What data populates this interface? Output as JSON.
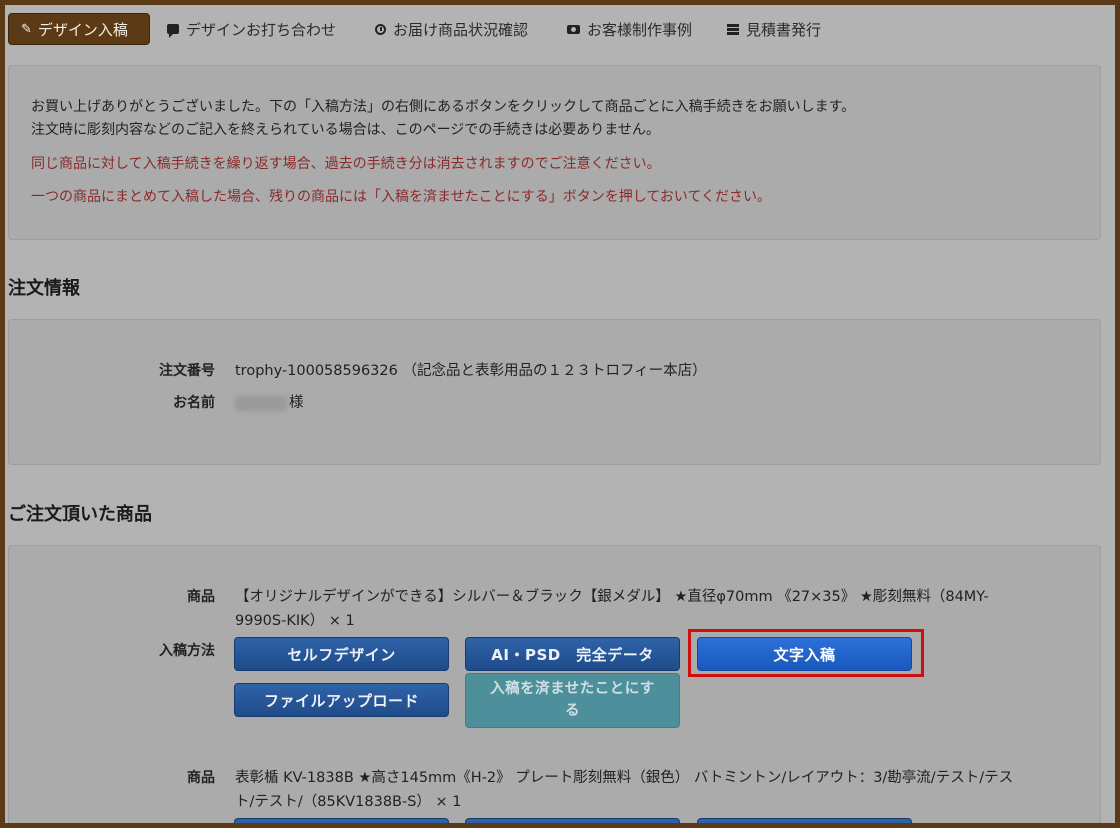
{
  "nav": {
    "items": [
      {
        "label": "デザイン入稿",
        "icon": "edit-icon",
        "active": true
      },
      {
        "label": "デザインお打ち合わせ",
        "icon": "chat-icon",
        "active": false
      },
      {
        "label": "お届け商品状況確認",
        "icon": "clock-icon",
        "active": false
      },
      {
        "label": "お客様制作事例",
        "icon": "camera-icon",
        "active": false
      },
      {
        "label": "見積書発行",
        "icon": "list-icon",
        "active": false
      }
    ]
  },
  "notice": {
    "line1": "お買い上げありがとうございました。下の「入稿方法」の右側にあるボタンをクリックして商品ごとに入稿手続きをお願いします。",
    "line2": "注文時に彫刻内容などのご記入を終えられている場合は、このページでの手続きは必要ありません。",
    "warn1": "同じ商品に対して入稿手続きを繰り返す場合、過去の手続き分は消去されますのでご注意ください。",
    "warn2": "一つの商品にまとめて入稿した場合、残りの商品には「入稿を済ませたことにする」ボタンを押しておいてください。"
  },
  "order_info": {
    "title": "注文情報",
    "order_number_label": "注文番号",
    "order_number_value": "trophy-100058596326 （記念品と表彰用品の１２３トロフィー本店）",
    "name_label": "お名前",
    "name_suffix": "様"
  },
  "products": {
    "title": "ご注文頂いた商品",
    "product_label": "商品",
    "method_label": "入稿方法",
    "item1": {
      "line1": "【オリジナルデザインができる】シルバー＆ブラック【銀メダル】 ★直径φ70mm 《27×35》 ★彫刻無料（84MY-",
      "line2": "9990S-KIK） × 1"
    },
    "item2": {
      "line1": "表彰楯 KV-1838B ★高さ145mm《H-2》 プレート彫刻無料（銀色） バトミントン/レイアウト：3/勘亭流/テスト/テス",
      "line2": "ト/テスト/（85KV1838B-S） × 1"
    },
    "buttons": {
      "self_design": "セルフデザイン",
      "full_data": "AI・PSD　完全データ",
      "text_submit": "文字入稿",
      "file_upload": "ファイルアップロード",
      "mark_done_1": "入稿を済ませたことにす",
      "mark_done_2": "る"
    }
  },
  "colors": {
    "active_tab": "#5b3a15",
    "button_blue": "#1f4b8a",
    "highlight": "#d01010",
    "warning_text": "#8b2a2a"
  }
}
